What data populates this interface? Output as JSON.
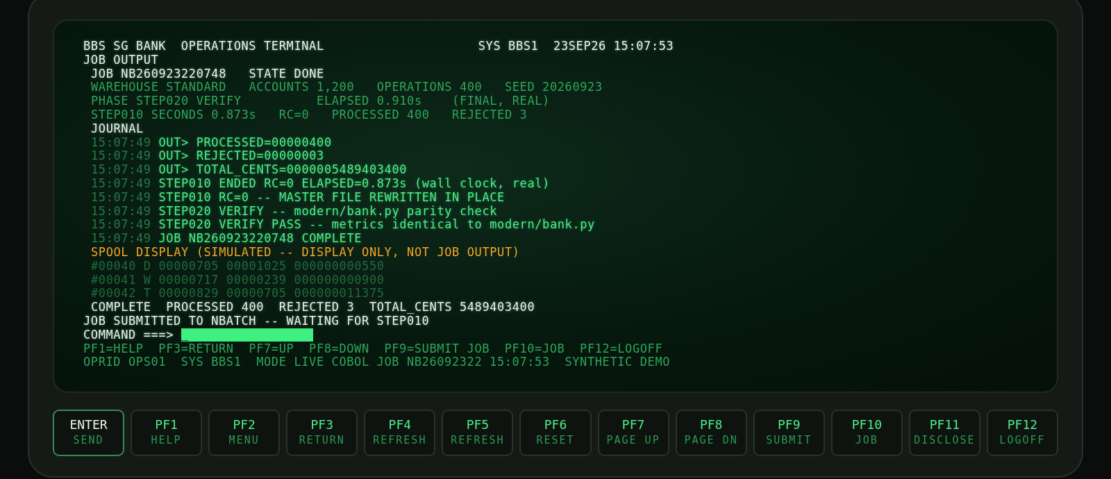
{
  "header": {
    "title": "BBS SG BANK  OPERATIONS TERMINAL",
    "system": "SYS BBS1  23SEP26 15:07:53"
  },
  "lines": [
    {
      "kind": "heading",
      "indented": false,
      "text": "JOB OUTPUT"
    },
    {
      "kind": "heading",
      "indented": true,
      "text": "JOB NB260923220748   STATE DONE"
    },
    {
      "kind": "info",
      "indented": true,
      "text": "WAREHOUSE STANDARD   ACCOUNTS 1,200   OPERATIONS 400   SEED 20260923"
    },
    {
      "kind": "info",
      "indented": true,
      "text": "PHASE STEP020 VERIFY          ELAPSED 0.910s    (FINAL, REAL)"
    },
    {
      "kind": "info",
      "indented": true,
      "text": "STEP010 SECONDS 0.873s   RC=0   PROCESSED 400   REJECTED 3"
    },
    {
      "kind": "heading",
      "indented": true,
      "text": "JOURNAL"
    },
    {
      "kind": "journal",
      "indented": true,
      "time": "15:07:49",
      "text": "OUT> PROCESSED=00000400"
    },
    {
      "kind": "journal",
      "indented": true,
      "time": "15:07:49",
      "text": "OUT> REJECTED=00000003"
    },
    {
      "kind": "journal",
      "indented": true,
      "time": "15:07:49",
      "text": "OUT> TOTAL_CENTS=0000005489403400"
    },
    {
      "kind": "journal",
      "indented": true,
      "time": "15:07:49",
      "text": "STEP010 ENDED RC=0 ELAPSED=0.873s (wall clock, real)"
    },
    {
      "kind": "journal",
      "indented": true,
      "time": "15:07:49",
      "text": "STEP010 RC=0 -- MASTER FILE REWRITTEN IN PLACE"
    },
    {
      "kind": "journal",
      "indented": true,
      "time": "15:07:49",
      "text": "STEP020 VERIFY -- modern/bank.py parity check"
    },
    {
      "kind": "journal",
      "indented": true,
      "time": "15:07:49",
      "text": "STEP020 VERIFY PASS -- metrics identical to modern/bank.py"
    },
    {
      "kind": "journal",
      "indented": true,
      "time": "15:07:49",
      "text": "JOB NB260923220748 COMPLETE"
    },
    {
      "kind": "warning",
      "indented": true,
      "text": "SPOOL DISPLAY (SIMULATED -- DISPLAY ONLY, NOT JOB OUTPUT)"
    },
    {
      "kind": "record",
      "indented": true,
      "text": "#00040 D 00000705 00001025 000000000550"
    },
    {
      "kind": "record",
      "indented": true,
      "text": "#00041 W 00000717 00000239 000000000900"
    },
    {
      "kind": "record",
      "indented": true,
      "text": "#00042 T 00000829 00000705 000000011375"
    },
    {
      "kind": "heading",
      "indented": true,
      "text": "COMPLETE  PROCESSED 400  REJECTED 3  TOTAL_CENTS 5489403400"
    },
    {
      "kind": "heading",
      "indented": false,
      "text": "JOB SUBMITTED TO NBATCH -- WAITING FOR STEP010"
    }
  ],
  "command": {
    "label": "COMMAND ===>",
    "value": "_"
  },
  "footer": [
    {
      "kind": "legend",
      "text": "PF1=HELP  PF3=RETURN  PF7=UP  PF8=DOWN  PF9=SUBMIT JOB  PF10=JOB  PF12=LOGOFF"
    },
    {
      "kind": "legend",
      "text": "OPRID OPS01  SYS BBS1  MODE LIVE COBOL JOB NB26092322 15:07:53  SYNTHETIC DEMO"
    }
  ],
  "keys": [
    {
      "key": "ENTER",
      "action": "SEND",
      "selected": true
    },
    {
      "key": "PF1",
      "action": "HELP",
      "selected": false
    },
    {
      "key": "PF2",
      "action": "MENU",
      "selected": false
    },
    {
      "key": "PF3",
      "action": "RETURN",
      "selected": false
    },
    {
      "key": "PF4",
      "action": "REFRESH",
      "selected": false
    },
    {
      "key": "PF5",
      "action": "REFRESH",
      "selected": false
    },
    {
      "key": "PF6",
      "action": "RESET",
      "selected": false
    },
    {
      "key": "PF7",
      "action": "PAGE UP",
      "selected": false
    },
    {
      "key": "PF8",
      "action": "PAGE DN",
      "selected": false
    },
    {
      "key": "PF9",
      "action": "SUBMIT",
      "selected": false
    },
    {
      "key": "PF10",
      "action": "JOB",
      "selected": false
    },
    {
      "key": "PF11",
      "action": "DISCLOSE",
      "selected": false
    },
    {
      "key": "PF12",
      "action": "LOGOFF",
      "selected": false
    }
  ]
}
